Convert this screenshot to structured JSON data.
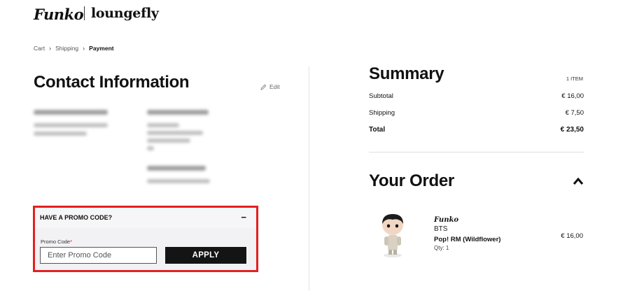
{
  "header": {
    "brand_primary": "Funko",
    "brand_secondary": "loungefly"
  },
  "breadcrumb": {
    "items": [
      "Cart",
      "Shipping",
      "Payment"
    ],
    "separator": "›"
  },
  "contact": {
    "title": "Contact Information",
    "edit_label": "Edit"
  },
  "promo": {
    "heading": "HAVE A PROMO CODE?",
    "collapse_symbol": "−",
    "field_label": "Promo Code",
    "required_marker": "*",
    "placeholder": "Enter Promo Code",
    "apply_label": "APPLY",
    "highlight_color": "#e32020"
  },
  "summary": {
    "title": "Summary",
    "item_count": "1 ITEM",
    "rows": [
      {
        "label": "Subtotal",
        "value": "€ 16,00"
      },
      {
        "label": "Shipping",
        "value": "€ 7,50"
      },
      {
        "label": "Total",
        "value": "€ 23,50"
      }
    ]
  },
  "order": {
    "title": "Your Order",
    "toggle_icon": "chevron-up-icon",
    "product": {
      "brand": "Funko",
      "line": "BTS",
      "name": "Pop! RM (Wildflower)",
      "qty": "Qty: 1",
      "price": "€ 16,00"
    }
  }
}
